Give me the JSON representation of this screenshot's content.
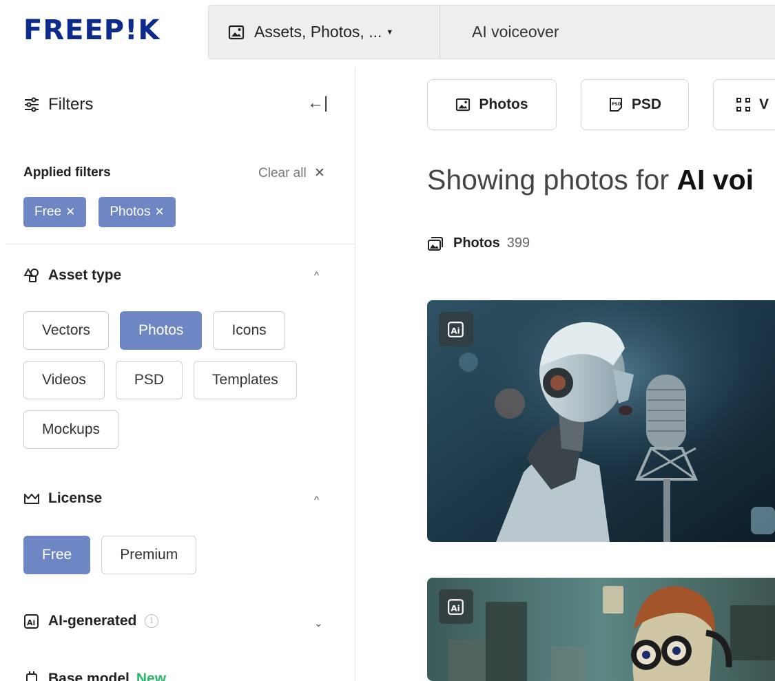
{
  "header": {
    "logo": "FREEP!K",
    "asset_select": "Assets, Photos, ...",
    "search_value": "AI voiceover"
  },
  "sidebar": {
    "filters_title": "Filters",
    "applied_title": "Applied filters",
    "clear_all": "Clear all",
    "applied_chips": [
      "Free",
      "Photos"
    ],
    "asset_type": {
      "title": "Asset type",
      "options": [
        "Vectors",
        "Photos",
        "Icons",
        "Videos",
        "PSD",
        "Templates",
        "Mockups"
      ],
      "selected": "Photos"
    },
    "license": {
      "title": "License",
      "options": [
        "Free",
        "Premium"
      ],
      "selected": "Free"
    },
    "ai_generated": {
      "title": "AI-generated",
      "info": "i"
    },
    "base_model": {
      "title": "Base model",
      "badge": "New"
    }
  },
  "main": {
    "type_tabs": [
      "Photos",
      "PSD",
      "V"
    ],
    "heading_prefix": "Showing photos for ",
    "heading_query": "AI voi",
    "count_label": "Photos",
    "count_value": "399"
  },
  "colors": {
    "brand_navy": "#0e2a8a",
    "chip_blue": "#6f86c4",
    "new_green": "#2bb56b"
  }
}
